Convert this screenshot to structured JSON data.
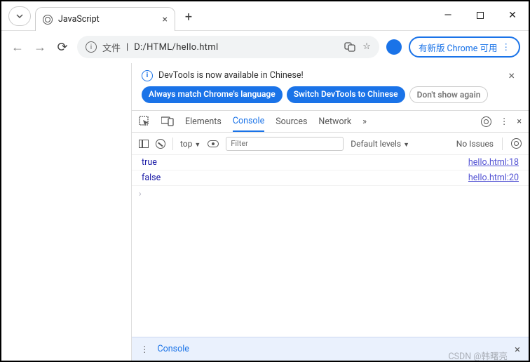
{
  "window": {
    "minimize": "—",
    "close": "✕"
  },
  "tab": {
    "title": "JavaScript"
  },
  "toolbar": {
    "file_label": "文件",
    "url": "D:/HTML/hello.html",
    "update_chip": "有新版 Chrome 可用"
  },
  "notice": {
    "text": "DevTools is now available in Chinese!",
    "btn_match": "Always match Chrome's language",
    "btn_switch": "Switch DevTools to Chinese",
    "btn_dismiss": "Don't show again"
  },
  "devtabs": {
    "elements": "Elements",
    "console": "Console",
    "sources": "Sources",
    "network": "Network"
  },
  "console_toolbar": {
    "context": "top",
    "filter_placeholder": "Filter",
    "levels": "Default levels",
    "issues": "No Issues"
  },
  "console_rows": [
    {
      "value": "true",
      "source": "hello.html:18"
    },
    {
      "value": "false",
      "source": "hello.html:20"
    }
  ],
  "drawer": {
    "label": "Console"
  },
  "watermark": "CSDN @韩曙亮"
}
